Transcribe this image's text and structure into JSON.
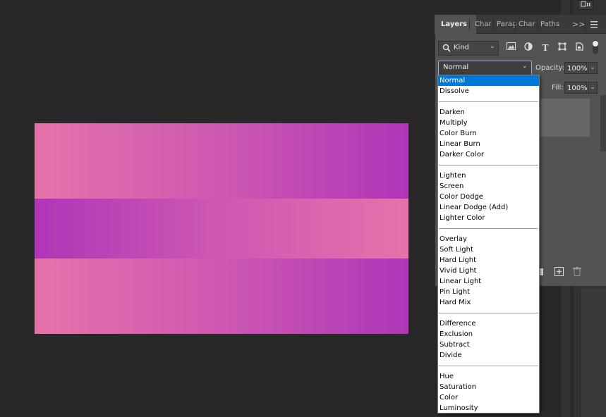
{
  "canvas": {
    "colors": {
      "pink": "#e673ab",
      "mid": "#cb55b2",
      "purple": "#b035b8"
    }
  },
  "workspace": {
    "top_right_icon": "arrange-documents-icon"
  },
  "panel": {
    "tabs": [
      {
        "label": "Layers",
        "active": true
      },
      {
        "label": "Char",
        "active": false
      },
      {
        "label": "Parag",
        "active": false
      },
      {
        "label": "Char",
        "active": false
      },
      {
        "label": "Paths",
        "active": false
      }
    ],
    "overflow_icon": "double-chevron-right-icon",
    "menu_icon": "panel-menu-icon",
    "filter": {
      "kind_label": "Kind",
      "icons": [
        "image-filter-icon",
        "adjustment-filter-icon",
        "type-filter-icon",
        "shape-filter-icon",
        "smart-object-filter-icon"
      ],
      "toggle_icon": "filter-toggle-icon"
    },
    "blend_mode": {
      "value": "Normal"
    },
    "opacity": {
      "label": "Opacity:",
      "value": "100%"
    },
    "fill": {
      "label": "Fill:",
      "value": "100%"
    },
    "bottom_icons": [
      "new-layer-icon",
      "delete-layer-icon"
    ]
  },
  "blend_dropdown": {
    "selected": "Normal",
    "groups": [
      [
        "Normal",
        "Dissolve"
      ],
      [
        "Darken",
        "Multiply",
        "Color Burn",
        "Linear Burn",
        "Darker Color"
      ],
      [
        "Lighten",
        "Screen",
        "Color Dodge",
        "Linear Dodge (Add)",
        "Lighter Color"
      ],
      [
        "Overlay",
        "Soft Light",
        "Hard Light",
        "Vivid Light",
        "Linear Light",
        "Pin Light",
        "Hard Mix"
      ],
      [
        "Difference",
        "Exclusion",
        "Subtract",
        "Divide"
      ],
      [
        "Hue",
        "Saturation",
        "Color",
        "Luminosity"
      ]
    ]
  }
}
